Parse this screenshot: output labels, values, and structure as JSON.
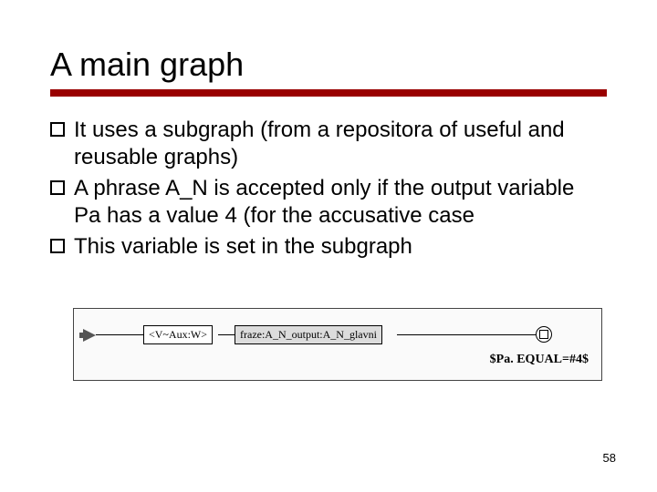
{
  "title": "A main graph",
  "bullets": [
    "It uses a subgraph (from a repositora of useful and reusable graphs)",
    "A phrase A_N is accepted only if the output variable Pa has a value 4 (for the accusative case",
    "This variable is set in the subgraph"
  ],
  "diagram": {
    "box1": "<V~Aux:W>",
    "box2": "fraze:A_N_output:A_N_glavni",
    "constraint": "$Pa. EQUAL=#4$"
  },
  "page_number": "58"
}
